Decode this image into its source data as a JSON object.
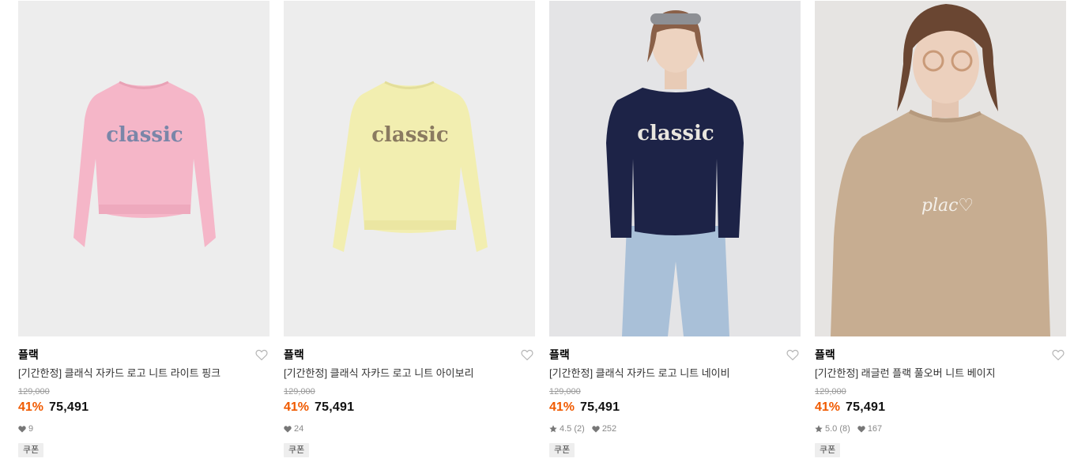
{
  "products": [
    {
      "brand": "플랙",
      "title": "[기간한정] 클래식 자카드 로고 니트 라이트 핑크",
      "original_price": "129,000",
      "discount": "41%",
      "price": "75,491",
      "likes": "9",
      "coupon": "쿠폰",
      "image_text": "classic",
      "colors": {
        "bg": "#ededed",
        "item": "#f5b6c8"
      }
    },
    {
      "brand": "플랙",
      "title": "[기간한정] 클래식 자카드 로고 니트 아이보리",
      "original_price": "129,000",
      "discount": "41%",
      "price": "75,491",
      "likes": "24",
      "coupon": "쿠폰",
      "image_text": "classic",
      "colors": {
        "bg": "#ededed",
        "item": "#f2eeb0"
      }
    },
    {
      "brand": "플랙",
      "title": "[기간한정] 클래식 자카드 로고 니트 네이비",
      "original_price": "129,000",
      "discount": "41%",
      "price": "75,491",
      "rating": "4.5",
      "reviews": "(2)",
      "likes": "252",
      "coupon": "쿠폰",
      "image_text": "classic",
      "colors": {
        "bg": "#e4e4e6",
        "item": "#1d2347"
      }
    },
    {
      "brand": "플랙",
      "title": "[기간한정] 래글런 플랙 풀오버 니트 베이지",
      "original_price": "129,000",
      "discount": "41%",
      "price": "75,491",
      "rating": "5.0",
      "reviews": "(8)",
      "likes": "167",
      "coupon": "쿠폰",
      "image_text": "plac♡",
      "colors": {
        "bg": "#e6e4e2",
        "item": "#c7ad91"
      }
    }
  ],
  "colors": {
    "discount": "#f05a00",
    "strike": "#999999",
    "coupon_bg": "#eeeeee"
  },
  "icons": {
    "wishlist": "heart-outline-icon",
    "likes": "heart-filled-icon",
    "rating": "star-icon"
  }
}
